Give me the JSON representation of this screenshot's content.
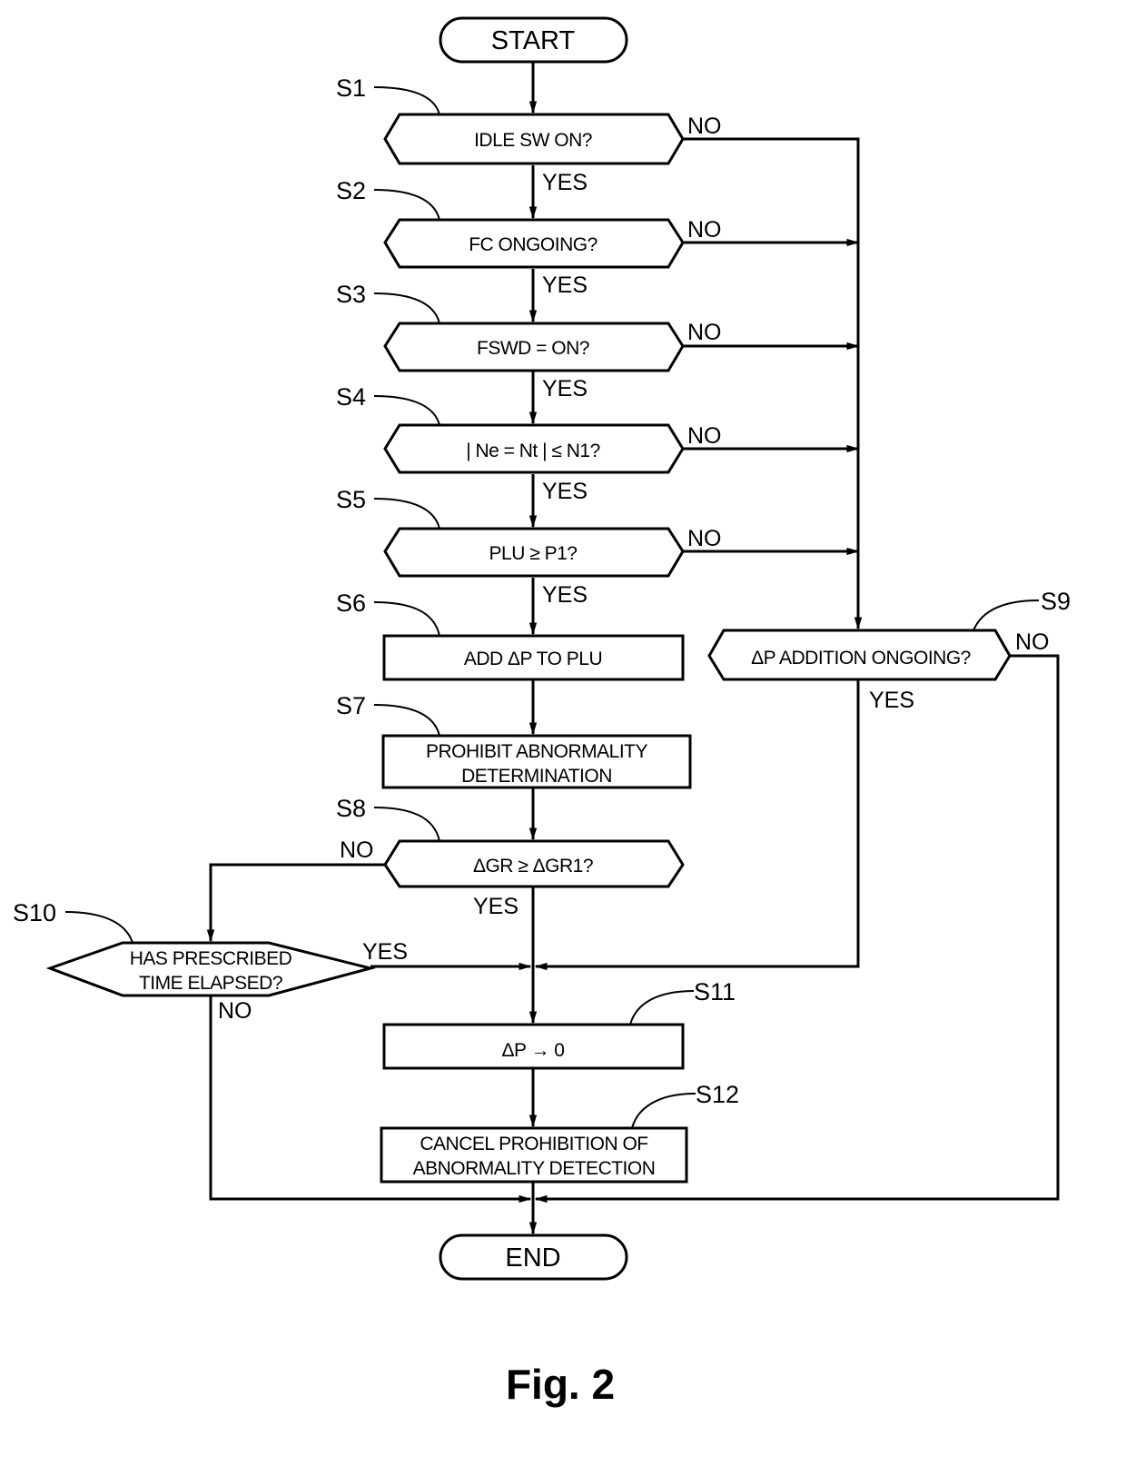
{
  "figure": {
    "caption": "Fig. 2"
  },
  "terminals": {
    "start": "START",
    "end": "END"
  },
  "steps": {
    "S1": {
      "id": "S1",
      "text": "IDLE SW ON?"
    },
    "S2": {
      "id": "S2",
      "text": "FC ONGOING?"
    },
    "S3": {
      "id": "S3",
      "text": "FSWD = ON?"
    },
    "S4": {
      "id": "S4",
      "text": "| Ne = Nt | ≤ N1?"
    },
    "S5": {
      "id": "S5",
      "text": "PLU ≥ P1?"
    },
    "S6": {
      "id": "S6",
      "text": "ADD ΔP TO PLU"
    },
    "S7": {
      "id": "S7",
      "line1": "PROHIBIT ABNORMALITY",
      "line2": "DETERMINATION"
    },
    "S8": {
      "id": "S8",
      "text": "ΔGR ≥ ΔGR1?"
    },
    "S9": {
      "id": "S9",
      "text": "ΔP ADDITION ONGOING?"
    },
    "S10": {
      "id": "S10",
      "line1": "HAS PRESCRIBED",
      "line2": "TIME ELAPSED?"
    },
    "S11": {
      "id": "S11",
      "text": "ΔP → 0"
    },
    "S12": {
      "id": "S12",
      "line1": "CANCEL PROHIBITION OF",
      "line2": "ABNORMALITY DETECTION"
    }
  },
  "branch_labels": {
    "yes": "YES",
    "no": "NO"
  }
}
